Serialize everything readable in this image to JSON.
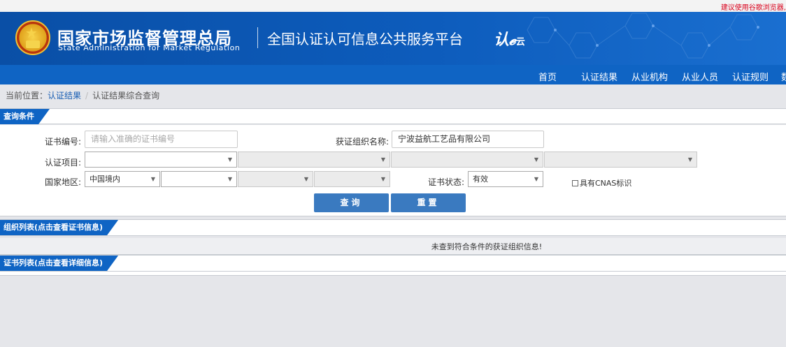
{
  "topbar": {
    "tip": "建议使用谷歌浏览器,"
  },
  "header": {
    "agency_cn": "国家市场监督管理总局",
    "agency_en": "State Administration  for  Market Regulation",
    "platform": "全国认证认可信息公共服务平台",
    "logo_text": "认",
    "logo_sub": "云"
  },
  "nav": {
    "items": [
      {
        "label": "首页"
      },
      {
        "label": "认证结果"
      },
      {
        "label": "从业机构"
      },
      {
        "label": "从业人员"
      },
      {
        "label": "认证规则"
      },
      {
        "label": "数"
      }
    ]
  },
  "breadcrumb": {
    "prefix": "当前位置：",
    "link": "认证结果",
    "separator": "/",
    "current": "认证结果综合查询"
  },
  "query": {
    "section_title": "查询条件",
    "cert_no_label": "证书编号:",
    "cert_no_placeholder": "请输入准确的证书编号",
    "org_name_label": "获证组织名称:",
    "org_name_value": "宁波益航工艺品有限公司",
    "project_label": "认证项目:",
    "region_label": "国家地区:",
    "region_value": "中国境内",
    "status_label": "证书状态:",
    "status_value": "有效",
    "cnas_label": "具有CNAS标识",
    "search_button": "查询",
    "reset_button": "重置"
  },
  "org_list": {
    "section_title": "组织列表(点击查看证书信息)",
    "empty_message": "未查到符合条件的获证组织信息!"
  },
  "cert_list": {
    "section_title": "证书列表(点击查看详细信息)"
  },
  "colors": {
    "brand_blue": "#0f64c4",
    "button_blue": "#3a7ac0",
    "tip_red": "#d9001b"
  }
}
